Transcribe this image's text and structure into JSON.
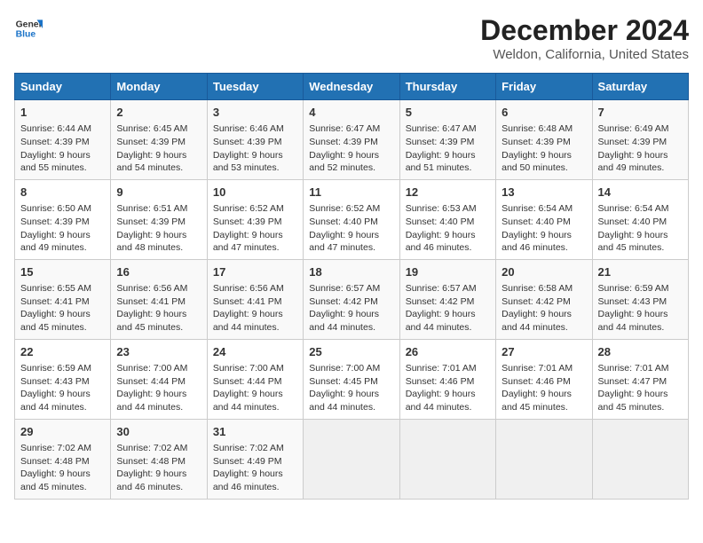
{
  "header": {
    "logo_line1": "General",
    "logo_line2": "Blue",
    "main_title": "December 2024",
    "subtitle": "Weldon, California, United States"
  },
  "days_of_week": [
    "Sunday",
    "Monday",
    "Tuesday",
    "Wednesday",
    "Thursday",
    "Friday",
    "Saturday"
  ],
  "weeks": [
    [
      {
        "day": "1",
        "sunrise": "6:44 AM",
        "sunset": "4:39 PM",
        "daylight": "9 hours and 55 minutes."
      },
      {
        "day": "2",
        "sunrise": "6:45 AM",
        "sunset": "4:39 PM",
        "daylight": "9 hours and 54 minutes."
      },
      {
        "day": "3",
        "sunrise": "6:46 AM",
        "sunset": "4:39 PM",
        "daylight": "9 hours and 53 minutes."
      },
      {
        "day": "4",
        "sunrise": "6:47 AM",
        "sunset": "4:39 PM",
        "daylight": "9 hours and 52 minutes."
      },
      {
        "day": "5",
        "sunrise": "6:47 AM",
        "sunset": "4:39 PM",
        "daylight": "9 hours and 51 minutes."
      },
      {
        "day": "6",
        "sunrise": "6:48 AM",
        "sunset": "4:39 PM",
        "daylight": "9 hours and 50 minutes."
      },
      {
        "day": "7",
        "sunrise": "6:49 AM",
        "sunset": "4:39 PM",
        "daylight": "9 hours and 49 minutes."
      }
    ],
    [
      {
        "day": "8",
        "sunrise": "6:50 AM",
        "sunset": "4:39 PM",
        "daylight": "9 hours and 49 minutes."
      },
      {
        "day": "9",
        "sunrise": "6:51 AM",
        "sunset": "4:39 PM",
        "daylight": "9 hours and 48 minutes."
      },
      {
        "day": "10",
        "sunrise": "6:52 AM",
        "sunset": "4:39 PM",
        "daylight": "9 hours and 47 minutes."
      },
      {
        "day": "11",
        "sunrise": "6:52 AM",
        "sunset": "4:40 PM",
        "daylight": "9 hours and 47 minutes."
      },
      {
        "day": "12",
        "sunrise": "6:53 AM",
        "sunset": "4:40 PM",
        "daylight": "9 hours and 46 minutes."
      },
      {
        "day": "13",
        "sunrise": "6:54 AM",
        "sunset": "4:40 PM",
        "daylight": "9 hours and 46 minutes."
      },
      {
        "day": "14",
        "sunrise": "6:54 AM",
        "sunset": "4:40 PM",
        "daylight": "9 hours and 45 minutes."
      }
    ],
    [
      {
        "day": "15",
        "sunrise": "6:55 AM",
        "sunset": "4:41 PM",
        "daylight": "9 hours and 45 minutes."
      },
      {
        "day": "16",
        "sunrise": "6:56 AM",
        "sunset": "4:41 PM",
        "daylight": "9 hours and 45 minutes."
      },
      {
        "day": "17",
        "sunrise": "6:56 AM",
        "sunset": "4:41 PM",
        "daylight": "9 hours and 44 minutes."
      },
      {
        "day": "18",
        "sunrise": "6:57 AM",
        "sunset": "4:42 PM",
        "daylight": "9 hours and 44 minutes."
      },
      {
        "day": "19",
        "sunrise": "6:57 AM",
        "sunset": "4:42 PM",
        "daylight": "9 hours and 44 minutes."
      },
      {
        "day": "20",
        "sunrise": "6:58 AM",
        "sunset": "4:42 PM",
        "daylight": "9 hours and 44 minutes."
      },
      {
        "day": "21",
        "sunrise": "6:59 AM",
        "sunset": "4:43 PM",
        "daylight": "9 hours and 44 minutes."
      }
    ],
    [
      {
        "day": "22",
        "sunrise": "6:59 AM",
        "sunset": "4:43 PM",
        "daylight": "9 hours and 44 minutes."
      },
      {
        "day": "23",
        "sunrise": "7:00 AM",
        "sunset": "4:44 PM",
        "daylight": "9 hours and 44 minutes."
      },
      {
        "day": "24",
        "sunrise": "7:00 AM",
        "sunset": "4:44 PM",
        "daylight": "9 hours and 44 minutes."
      },
      {
        "day": "25",
        "sunrise": "7:00 AM",
        "sunset": "4:45 PM",
        "daylight": "9 hours and 44 minutes."
      },
      {
        "day": "26",
        "sunrise": "7:01 AM",
        "sunset": "4:46 PM",
        "daylight": "9 hours and 44 minutes."
      },
      {
        "day": "27",
        "sunrise": "7:01 AM",
        "sunset": "4:46 PM",
        "daylight": "9 hours and 45 minutes."
      },
      {
        "day": "28",
        "sunrise": "7:01 AM",
        "sunset": "4:47 PM",
        "daylight": "9 hours and 45 minutes."
      }
    ],
    [
      {
        "day": "29",
        "sunrise": "7:02 AM",
        "sunset": "4:48 PM",
        "daylight": "9 hours and 45 minutes."
      },
      {
        "day": "30",
        "sunrise": "7:02 AM",
        "sunset": "4:48 PM",
        "daylight": "9 hours and 46 minutes."
      },
      {
        "day": "31",
        "sunrise": "7:02 AM",
        "sunset": "4:49 PM",
        "daylight": "9 hours and 46 minutes."
      },
      null,
      null,
      null,
      null
    ]
  ]
}
